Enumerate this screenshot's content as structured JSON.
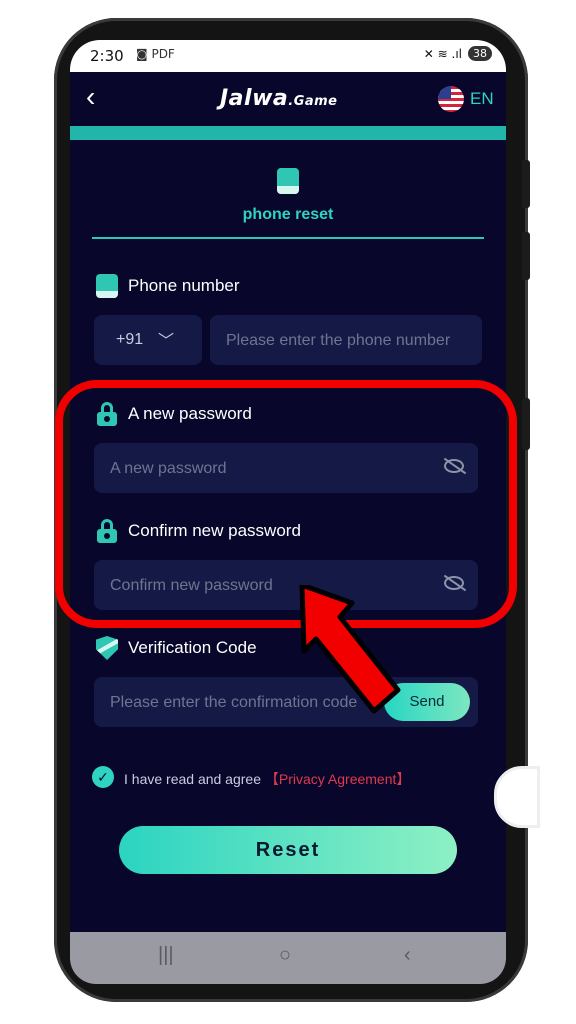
{
  "status_bar": {
    "time": "2:30",
    "small_icons": "◙ PDF",
    "signal_icons": "✕ ≋ .ıl",
    "battery": "38"
  },
  "header": {
    "back_glyph": "‹",
    "logo_main": "Jalwa",
    "logo_suffix": ".Game",
    "language": "EN"
  },
  "tab": {
    "label": "phone reset"
  },
  "phone_section": {
    "label": "Phone number",
    "country_code": "+91",
    "placeholder": "Please enter the phone number"
  },
  "new_password": {
    "label": "A new password",
    "placeholder": "A new password"
  },
  "confirm_password": {
    "label": "Confirm new password",
    "placeholder": "Confirm new password"
  },
  "verification": {
    "label": "Verification Code",
    "placeholder": "Please enter the confirmation code",
    "send_label": "Send"
  },
  "agreement": {
    "text": "I have read and agree",
    "link": "【Privacy Agreement】"
  },
  "reset_button": {
    "label": "Reset"
  },
  "colors": {
    "background": "#08062a",
    "accent": "#2fd3c2",
    "annotation": "#f20000"
  }
}
